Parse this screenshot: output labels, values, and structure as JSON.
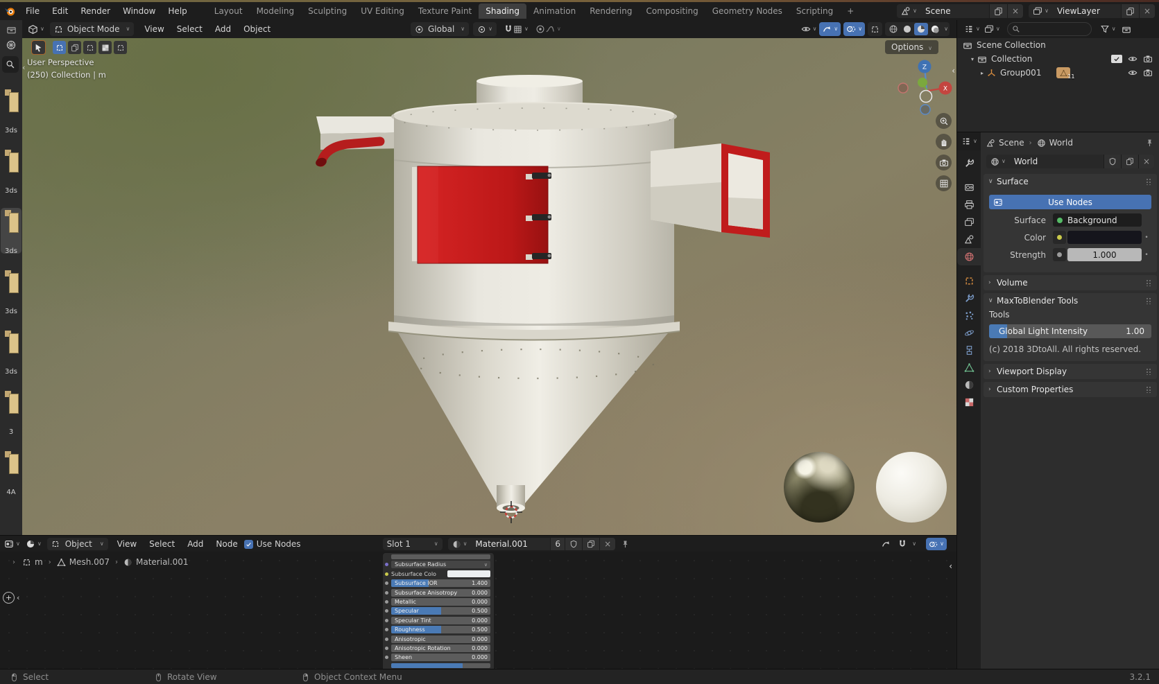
{
  "topbar": {
    "menus": [
      "File",
      "Edit",
      "Render",
      "Window",
      "Help"
    ],
    "workspaces": [
      "Layout",
      "Modeling",
      "Sculpting",
      "UV Editing",
      "Texture Paint",
      "Shading",
      "Animation",
      "Rendering",
      "Compositing",
      "Geometry Nodes",
      "Scripting",
      "+"
    ],
    "active_workspace": "Shading",
    "scene_name": "Scene",
    "viewlayer_name": "ViewLayer"
  },
  "viewport_header": {
    "mode": "Object Mode",
    "menus": [
      "View",
      "Select",
      "Add",
      "Object"
    ],
    "orientation": "Global"
  },
  "viewport": {
    "options_label": "Options",
    "overlay_line1": "User Perspective",
    "overlay_line2": "(250) Collection | m",
    "gizmo_z": "Z",
    "gizmo_x": "X"
  },
  "left_strip": {
    "files": [
      {
        "label": "3ds"
      },
      {
        "label": "3ds"
      },
      {
        "label": "3ds"
      },
      {
        "label": "3ds"
      },
      {
        "label": "3ds"
      },
      {
        "label": "3"
      },
      {
        "label": "4A"
      }
    ]
  },
  "outliner": {
    "rows": [
      {
        "label": "Scene Collection"
      },
      {
        "label": "Collection"
      },
      {
        "label": "Group001",
        "badge": "11"
      }
    ]
  },
  "properties": {
    "breadcrumb": {
      "scene": "Scene",
      "world": "World"
    },
    "world_field": "World",
    "surface_panel": {
      "title": "Surface",
      "use_nodes": "Use Nodes",
      "surface_label": "Surface",
      "surface_value": "Background",
      "color_label": "Color",
      "strength_label": "Strength",
      "strength_value": "1.000"
    },
    "volume_panel": "Volume",
    "maxtoblender": {
      "title": "MaxToBlender Tools",
      "tools_label": "Tools",
      "gli_label": "Global Light Intensity",
      "gli_value": "1.00",
      "copyright": "(c) 2018 3DtoAll. All rights reserved."
    },
    "viewport_display_panel": "Viewport Display",
    "custom_properties_panel": "Custom Properties"
  },
  "shader_editor": {
    "header": {
      "type": "Object",
      "menus": [
        "View",
        "Select",
        "Add",
        "Node"
      ],
      "use_nodes": "Use Nodes",
      "slot": "Slot 1",
      "material": "Material.001",
      "users": "6"
    },
    "breadcrumb": [
      "m",
      "Mesh.007",
      "Material.001"
    ],
    "node_rows": [
      {
        "label": "Subsurface Radius",
        "kind": "dropdown",
        "socket": "#7a70c9"
      },
      {
        "label": "Subsurface Colo",
        "kind": "color",
        "socket": "#c9c94b"
      },
      {
        "label": "Subsurface IOR",
        "value": "1.400",
        "fill": 0.38,
        "socket": "#9a9a9a"
      },
      {
        "label": "Subsurface Anisotropy",
        "value": "0.000",
        "fill": 0,
        "socket": "#9a9a9a"
      },
      {
        "label": "Metallic",
        "value": "0.000",
        "fill": 0,
        "socket": "#9a9a9a"
      },
      {
        "label": "Specular",
        "value": "0.500",
        "fill": 0.5,
        "socket": "#9a9a9a"
      },
      {
        "label": "Specular Tint",
        "value": "0.000",
        "fill": 0,
        "socket": "#9a9a9a"
      },
      {
        "label": "Roughness",
        "value": "0.500",
        "fill": 0.5,
        "socket": "#9a9a9a"
      },
      {
        "label": "Anisotropic",
        "value": "0.000",
        "fill": 0,
        "socket": "#9a9a9a"
      },
      {
        "label": "Anisotropic Rotation",
        "value": "0.000",
        "fill": 0,
        "socket": "#9a9a9a"
      },
      {
        "label": "Sheen",
        "value": "0.000",
        "fill": 0,
        "socket": "#9a9a9a"
      }
    ],
    "bottom_partial_fill": 0.72
  },
  "status_bar": {
    "items": [
      "Select",
      "Rotate View",
      "Object Context Menu"
    ],
    "version": "3.2.1"
  },
  "colors": {
    "accent": "#4772b3",
    "door_red": "#c01c1c"
  }
}
